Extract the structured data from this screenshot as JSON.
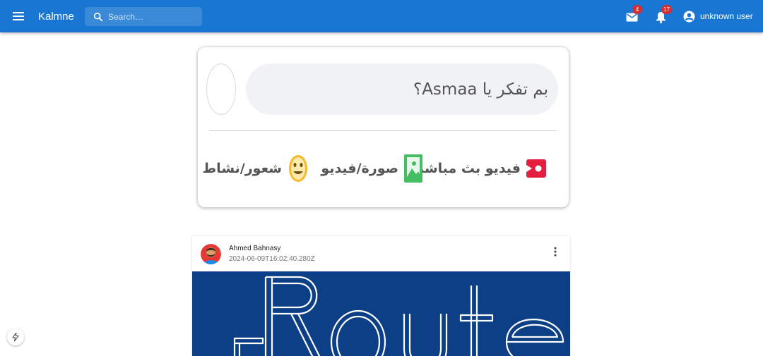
{
  "header": {
    "brand": "Kalmne",
    "search_placeholder": "Search…",
    "mail_badge": "4",
    "notifications_badge": "17",
    "user_name": "unknown user",
    "color": "#1976d2"
  },
  "composer": {
    "prompt": "بم تفكر يا Asmaa؟",
    "actions": [
      {
        "label": "فيديو بث مباشر",
        "icon": "live-video-icon",
        "color": "#e41e3f"
      },
      {
        "label": "صورة/فيديو",
        "icon": "photo-icon",
        "color": "#45bd62"
      },
      {
        "label": "شعور/نشاط",
        "icon": "smiley-icon",
        "color": "#f7b928"
      }
    ]
  },
  "post": {
    "author": "Ahmed Bahnasy",
    "timestamp": "2024-06-09T16:02:40.280Z",
    "media_text": "Route"
  }
}
